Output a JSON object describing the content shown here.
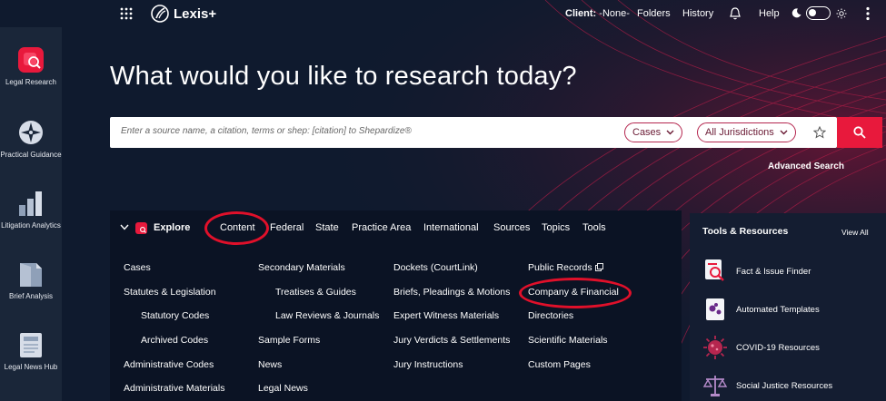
{
  "topbar": {
    "app_name": "Lexis+",
    "client_label": "Client:",
    "client_value": "-None-",
    "folders": "Folders",
    "history": "History",
    "help": "Help"
  },
  "rail": [
    {
      "label": "Legal Research"
    },
    {
      "label": "Practical Guidance"
    },
    {
      "label": "Litigation Analytics"
    },
    {
      "label": "Brief Analysis"
    },
    {
      "label": "Legal News Hub"
    }
  ],
  "headline": "What would you like to research today?",
  "search": {
    "placeholder": "Enter a source name, a citation, terms or shep: [citation] to Shepardize®",
    "content_type": "Cases",
    "jurisdiction": "All Jurisdictions",
    "advanced": "Advanced Search"
  },
  "explore": {
    "label": "Explore",
    "tabs": [
      "Content",
      "Federal",
      "State",
      "Practice Area",
      "International",
      "Sources",
      "Topics",
      "Tools"
    ],
    "active_tab": "Content",
    "columns": [
      [
        "Cases",
        "Statutes & Legislation",
        "Statutory Codes",
        "Archived Codes",
        "Administrative Codes",
        "Administrative Materials"
      ],
      [
        "Secondary Materials",
        "Treatises & Guides",
        "Law Reviews & Journals",
        "Sample Forms",
        "News",
        "Legal News"
      ],
      [
        "Dockets (CourtLink)",
        "Briefs, Pleadings & Motions",
        "Expert Witness Materials",
        "Jury Verdicts & Settlements",
        "Jury Instructions"
      ],
      [
        "Public Records",
        "Company & Financial",
        "Directories",
        "Scientific Materials",
        "Custom Pages"
      ]
    ]
  },
  "tools": {
    "title": "Tools & Resources",
    "view_all": "View All",
    "items": [
      {
        "label": "Fact & Issue Finder",
        "icon": "fact-finder-icon"
      },
      {
        "label": "Automated Templates",
        "icon": "templates-icon"
      },
      {
        "label": "COVID-19 Resources",
        "icon": "virus-icon"
      },
      {
        "label": "Social Justice Resources",
        "icon": "scales-icon"
      }
    ]
  },
  "colors": {
    "background": "#0f1a2e",
    "accent_red": "#e8193c",
    "annotation_red": "#e0102a",
    "pill_border": "#b5264f"
  }
}
